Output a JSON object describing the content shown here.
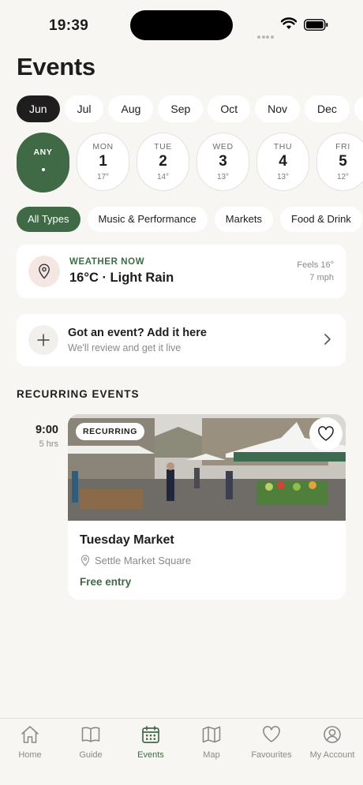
{
  "status_bar": {
    "time": "19:39"
  },
  "page_title": "Events",
  "months": [
    "Jun",
    "Jul",
    "Aug",
    "Sep",
    "Oct",
    "Nov",
    "Dec"
  ],
  "selected_month": "Jun",
  "days": {
    "any": {
      "label": "ANY",
      "marker": "•"
    },
    "items": [
      {
        "name": "MON",
        "num": "1",
        "temp": "17°"
      },
      {
        "name": "TUE",
        "num": "2",
        "temp": "14°"
      },
      {
        "name": "WED",
        "num": "3",
        "temp": "13°"
      },
      {
        "name": "THU",
        "num": "4",
        "temp": "13°"
      },
      {
        "name": "FRI",
        "num": "5",
        "temp": "12°"
      }
    ]
  },
  "types": [
    "All Types",
    "Music & Performance",
    "Markets",
    "Food & Drink"
  ],
  "selected_type": "All Types",
  "weather": {
    "kicker": "WEATHER NOW",
    "main": "16°C · Light Rain",
    "feels": "Feels 16°",
    "wind": "7 mph",
    "icon": "location-pin-icon"
  },
  "add_event": {
    "title": "Got an event? Add it here",
    "subtitle": "We'll review and get it live"
  },
  "section_title": "RECURRING EVENTS",
  "events": [
    {
      "time": "9:00",
      "duration": "5 hrs",
      "badge": "RECURRING",
      "title": "Tuesday Market",
      "location": "Settle Market Square",
      "price": "Free entry"
    }
  ],
  "tabs": [
    {
      "label": "Home",
      "icon": "home-icon"
    },
    {
      "label": "Guide",
      "icon": "book-icon"
    },
    {
      "label": "Events",
      "icon": "calendar-icon"
    },
    {
      "label": "Map",
      "icon": "map-icon"
    },
    {
      "label": "Favourites",
      "icon": "heart-icon"
    },
    {
      "label": "My Account",
      "icon": "account-icon"
    }
  ],
  "active_tab": "Events",
  "colors": {
    "accent": "#3f6a45",
    "background": "#f7f6f3",
    "dark_chip": "#1e1e1e"
  }
}
